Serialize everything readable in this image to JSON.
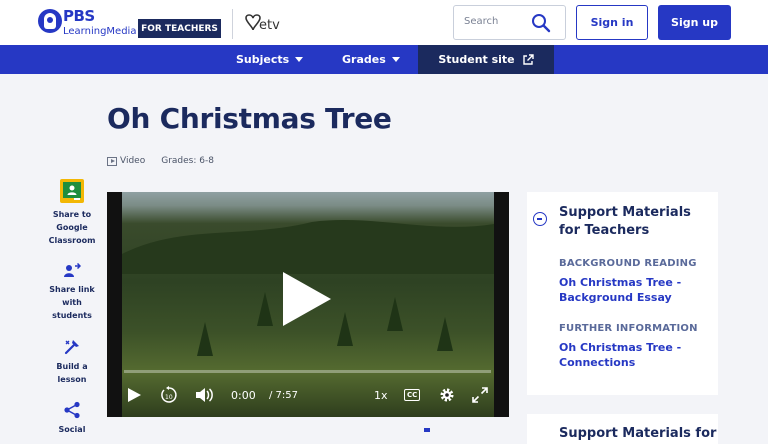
{
  "header": {
    "logo_text": "PBS",
    "logo_subtext": "LearningMedia",
    "badge": "FOR TEACHERS",
    "partner_logo": "etv",
    "search_placeholder": "Search",
    "signin_label": "Sign in",
    "signup_label": "Sign up"
  },
  "nav": {
    "subjects": "Subjects",
    "grades": "Grades",
    "student_site": "Student site"
  },
  "resource": {
    "title": "Oh Christmas Tree",
    "media_type": "Video",
    "grades": "Grades: 6-8"
  },
  "sidebar_tools": [
    {
      "label": "Share to Google Classroom",
      "icon": "google-classroom-icon"
    },
    {
      "label": "Share link with students",
      "icon": "share-link-icon"
    },
    {
      "label": "Build a lesson",
      "icon": "build-lesson-icon"
    },
    {
      "label": "Social",
      "icon": "share-icon"
    }
  ],
  "player": {
    "current_time": "0:00",
    "duration": "/ 7:57",
    "speed": "1x",
    "cc": "CC",
    "progress": 0
  },
  "support": {
    "title": "Support Materials for Teachers",
    "sections": [
      {
        "label": "BACKGROUND READING",
        "link": "Oh Christmas Tree - Background Essay"
      },
      {
        "label": "FURTHER INFORMATION",
        "link": "Oh Christmas Tree - Connections"
      }
    ],
    "next_card_title": "Support Materials for"
  },
  "colors": {
    "brand_blue": "#2638c4",
    "navy": "#1b2a5e",
    "background": "#f3f4f8"
  }
}
